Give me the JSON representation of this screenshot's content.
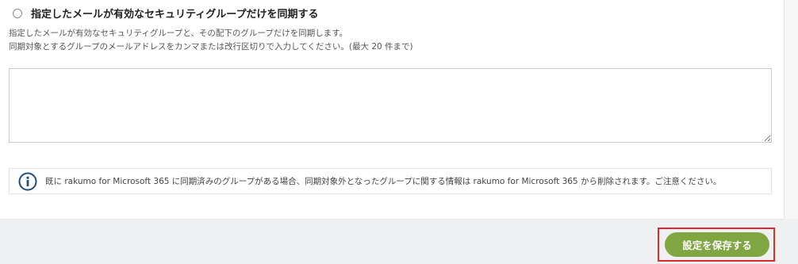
{
  "option": {
    "label": "指定したメールが有効なセキュリティグループだけを同期する",
    "selected": false
  },
  "description": {
    "line1": "指定したメールが有効なセキュリティグループと、その配下のグループだけを同期します。",
    "line2": "同期対象とするグループのメールアドレスをカンマまたは改行区切りで入力してください。(最大 20 件まで)"
  },
  "emails_input": {
    "value": ""
  },
  "notice": {
    "icon": "info-circle-icon",
    "text": "既に rakumo for Microsoft 365 に同期済みのグループがある場合、同期対象外となったグループに関する情報は rakumo for Microsoft 365 から削除されます。ご注意ください。"
  },
  "footer": {
    "save_label": "設定を保存する"
  },
  "colors": {
    "save_button": "#7fa640",
    "highlight_border": "#e0282e",
    "info_icon": "#1f4e79"
  }
}
